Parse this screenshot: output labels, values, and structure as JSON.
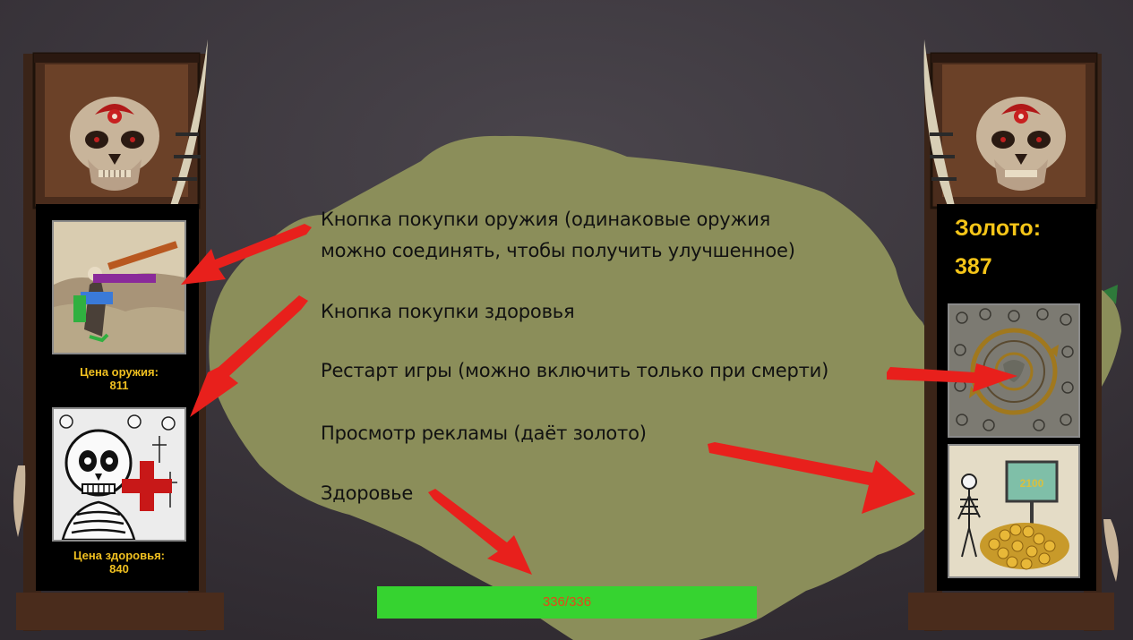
{
  "left_panel": {
    "weapon_button": {
      "icon": "machine-gun-skeleton-icon"
    },
    "weapon_price_label": "Цена оружия:",
    "weapon_price_value": "811",
    "health_button": {
      "icon": "skull-red-cross-icon"
    },
    "health_price_label": "Цена здоровья:",
    "health_price_value": "840"
  },
  "right_panel": {
    "gold_label": "Золото:",
    "gold_value": "387",
    "restart_button": {
      "icon": "restart-circle-icon"
    },
    "ad_button": {
      "icon": "skeleton-gold-pile-icon"
    },
    "ad_board_text": "2100"
  },
  "health_bar": {
    "text": "336/336",
    "current": 336,
    "max": 336,
    "fill_color": "#36d330"
  },
  "annotations": [
    {
      "text": "Кнопка покупки оружия (одинаковые оружия"
    },
    {
      "text": "можно соединять, чтобы получить улучшенное)"
    },
    {
      "text": "Кнопка покупки здоровья"
    },
    {
      "text": "Рестарт игры (можно включить только при смерти)"
    },
    {
      "text": "Просмотр рекламы (даёт золото)"
    },
    {
      "text": "Здоровье"
    }
  ],
  "colors": {
    "background": "#3e3940",
    "blob": "#8b8e5a",
    "arrow": "#e8201c",
    "price_text": "#f0c020",
    "gold_text": "#f5c518"
  }
}
